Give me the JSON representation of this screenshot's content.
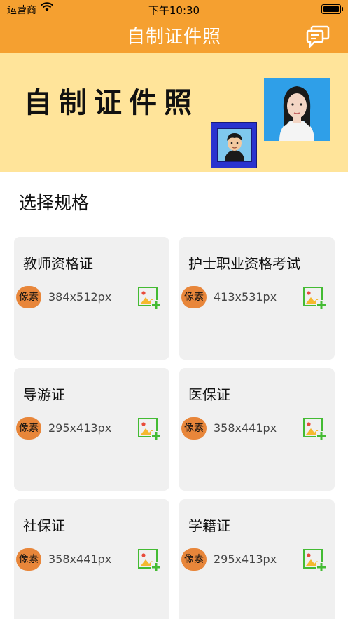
{
  "status": {
    "carrier": "运营商",
    "time": "下午10:30"
  },
  "nav": {
    "title": "自制证件照"
  },
  "banner": {
    "title": "自制证件照"
  },
  "section": {
    "title": "选择规格"
  },
  "cards": [
    {
      "name": "教师资格证",
      "badge": "像素",
      "size": "384x512px"
    },
    {
      "name": "护士职业资格考试",
      "badge": "像素",
      "size": "413x531px"
    },
    {
      "name": "导游证",
      "badge": "像素",
      "size": "295x413px"
    },
    {
      "name": "医保证",
      "badge": "像素",
      "size": "358x441px"
    },
    {
      "name": "社保证",
      "badge": "像素",
      "size": "358x441px"
    },
    {
      "name": "学籍证",
      "badge": "像素",
      "size": "295x413px"
    }
  ],
  "colors": {
    "accent": "#f5a030",
    "banner_bg": "#ffe49a",
    "card_bg": "#f0f0f0",
    "badge": "#e8863a",
    "add_icon": "#44bb33"
  }
}
